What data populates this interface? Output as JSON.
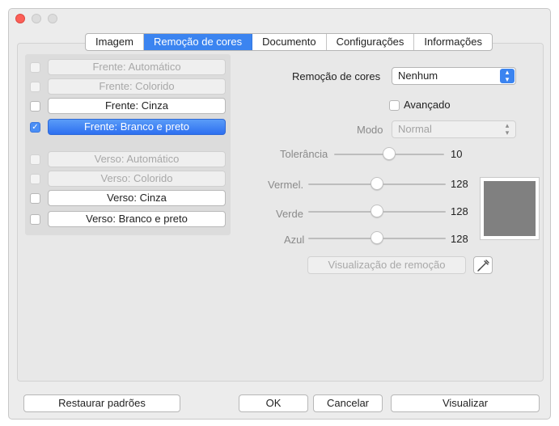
{
  "tabs": [
    {
      "label": "Imagem",
      "active": false
    },
    {
      "label": "Remoção de cores",
      "active": true
    },
    {
      "label": "Documento",
      "active": false
    },
    {
      "label": "Configurações",
      "active": false
    },
    {
      "label": "Informações",
      "active": false
    }
  ],
  "options": [
    {
      "label": "Frente: Automático",
      "checked": false,
      "enabled": false
    },
    {
      "label": "Frente: Colorido",
      "checked": false,
      "enabled": false
    },
    {
      "label": "Frente: Cinza",
      "checked": false,
      "enabled": true
    },
    {
      "label": "Frente: Branco e preto",
      "checked": true,
      "enabled": true
    },
    {
      "label": "Verso: Automático",
      "checked": false,
      "enabled": false
    },
    {
      "label": "Verso: Colorido",
      "checked": false,
      "enabled": false
    },
    {
      "label": "Verso: Cinza",
      "checked": false,
      "enabled": true
    },
    {
      "label": "Verso: Branco e preto",
      "checked": false,
      "enabled": true
    }
  ],
  "color_removal": {
    "label": "Remoção de cores",
    "value": "Nenhum"
  },
  "advanced": {
    "label": "Avançado",
    "checked": false
  },
  "mode": {
    "label": "Modo",
    "value": "Normal"
  },
  "sliders": {
    "tolerance": {
      "label": "Tolerância",
      "value": "10",
      "level": 0.5
    },
    "red": {
      "label": "Vermel.",
      "value": "128",
      "level": 0.5
    },
    "green": {
      "label": "Verde",
      "value": "128",
      "level": 0.5
    },
    "blue": {
      "label": "Azul",
      "value": "128",
      "level": 0.5
    }
  },
  "preview_color": "#808080",
  "accent_color": "#3b84f0",
  "buttons": {
    "preview_removal": "Visualização de remoção",
    "restore_defaults": "Restaurar padrões",
    "ok": "OK",
    "cancel": "Cancelar",
    "preview": "Visualizar"
  },
  "icons": {
    "eyedropper": "eyedropper-icon"
  }
}
